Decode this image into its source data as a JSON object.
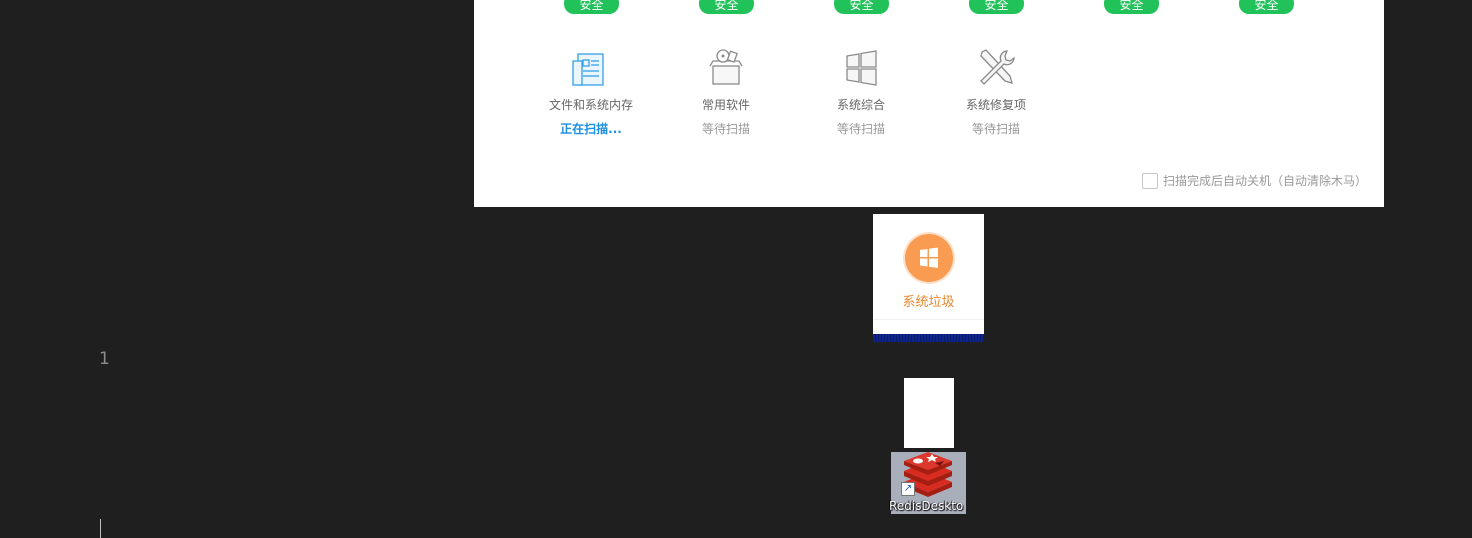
{
  "editor": {
    "line_number": "1"
  },
  "scan_panel": {
    "badges": [
      "安全",
      "安全",
      "安全",
      "安全",
      "安全",
      "安全"
    ],
    "items": [
      {
        "name": "文件和系统内存",
        "status": "正在扫描...",
        "icon": "document-icon",
        "active": true
      },
      {
        "name": "常用软件",
        "status": "等待扫描",
        "icon": "software-box-icon",
        "active": false
      },
      {
        "name": "系统综合",
        "status": "等待扫描",
        "icon": "windows-icon",
        "active": false
      },
      {
        "name": "系统修复项",
        "status": "等待扫描",
        "icon": "repair-tools-icon",
        "active": false
      }
    ],
    "auto_shutdown": {
      "label": "扫描完成后自动关机（自动清除木马）",
      "checked": false
    },
    "colors": {
      "safe_badge": "#21c25a",
      "scanning_text": "#1b8fe0"
    }
  },
  "junk_tile": {
    "label": "系统垃圾",
    "icon": "windows-icon",
    "accent": "#f99c51"
  },
  "desktop_shortcut": {
    "label": "RedisDeskto",
    "icon": "redis-icon"
  }
}
